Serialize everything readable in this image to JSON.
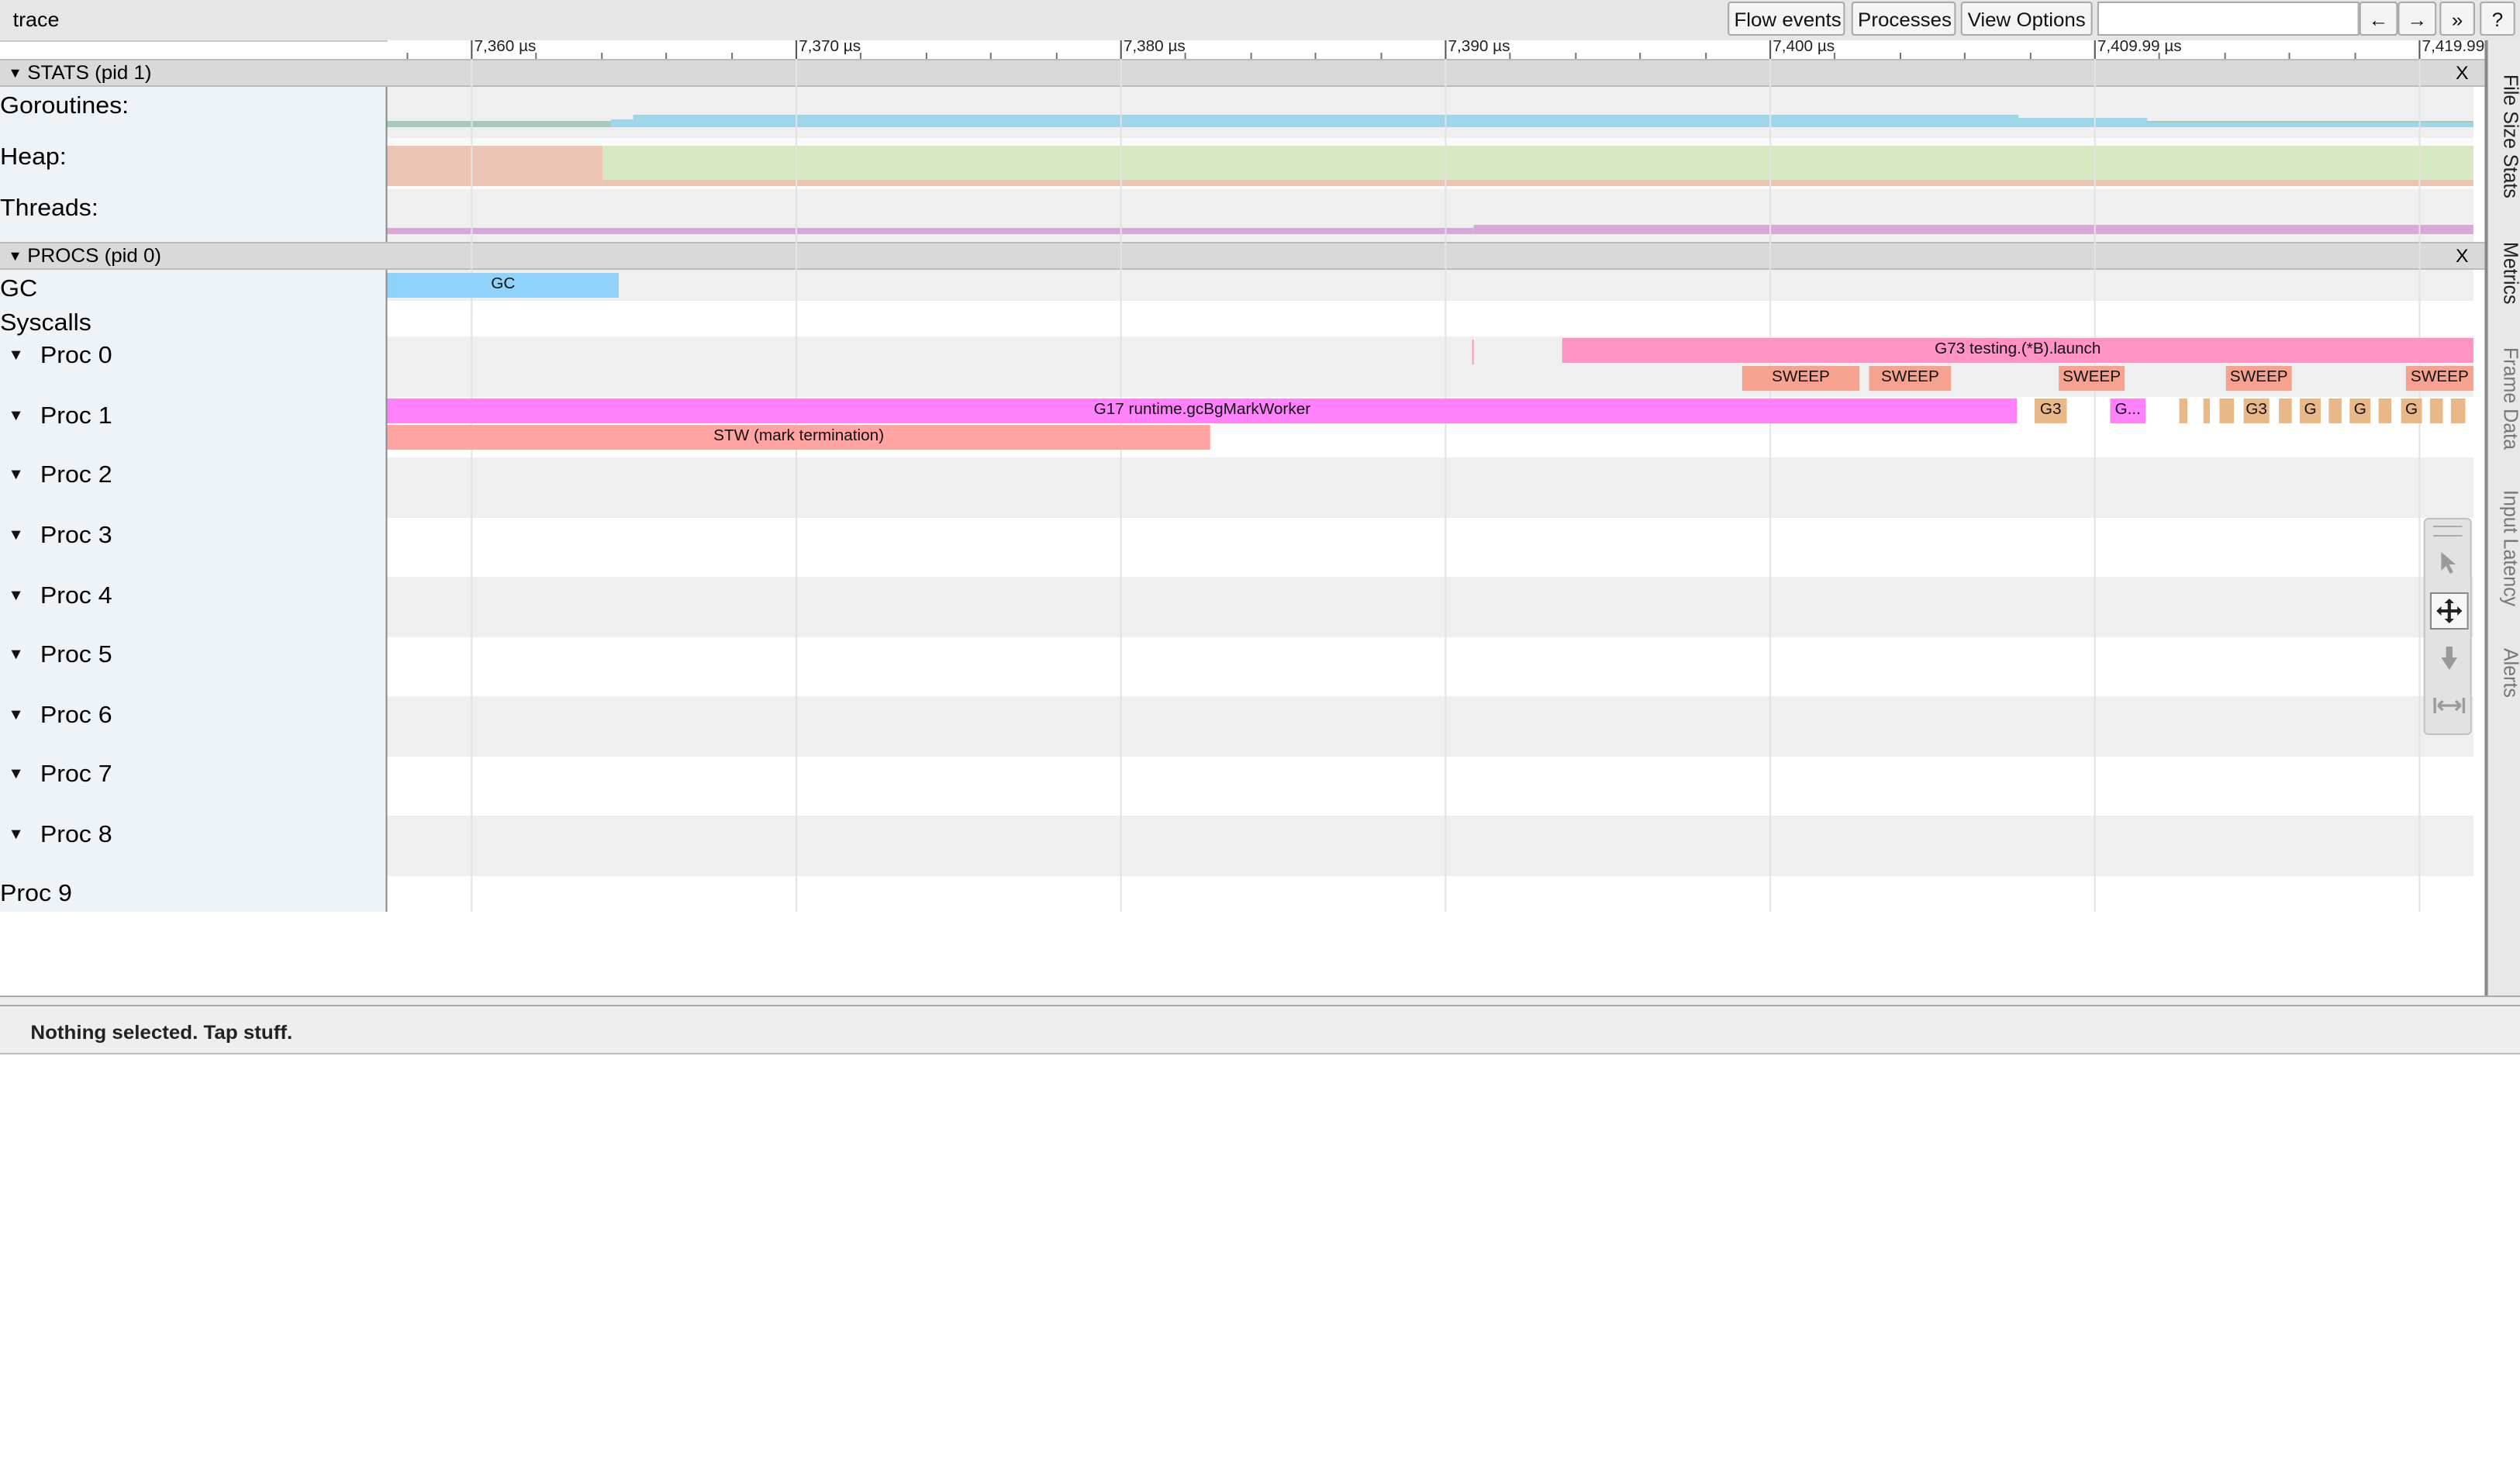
{
  "app": {
    "title": "trace"
  },
  "toolbar": {
    "flow_events": "Flow events",
    "processes": "Processes",
    "view_options": "View Options",
    "nav_prev": "←",
    "nav_next": "→",
    "nav_more": "»",
    "help": "?"
  },
  "ruler": {
    "labels": [
      "7,360 µs",
      "7,370 µs",
      "7,380 µs",
      "7,390 µs",
      "7,400 µs",
      "7,409.99 µs",
      "7,419.99"
    ]
  },
  "stats": {
    "header": "STATS (pid 1)",
    "close": "X",
    "tracks": [
      "Goroutines:",
      "Heap:",
      "Threads:"
    ]
  },
  "procs": {
    "header": "PROCS (pid 0)",
    "close": "X",
    "tracks": [
      "GC",
      "Syscalls",
      "Proc 0",
      "Proc 1",
      "Proc 2",
      "Proc 3",
      "Proc 4",
      "Proc 5",
      "Proc 6",
      "Proc 7",
      "Proc 8",
      "Proc 9"
    ]
  },
  "slices": {
    "gc": "GC",
    "g73": "G73 testing.(*B).launch",
    "sweep": "SWEEP",
    "g17": "G17 runtime.gcBgMarkWorker",
    "stw": "STW (mark termination)",
    "g3": "G3",
    "g_ellipsis": "G...",
    "g": "G"
  },
  "side_tabs": [
    "File Size Stats",
    "Metrics",
    "Frame Data",
    "Input Latency",
    "Alerts"
  ],
  "tools": [
    "select-icon",
    "pan-icon",
    "zoom-icon",
    "timing-icon"
  ],
  "status": {
    "text": "Nothing selected. Tap stuff."
  },
  "colors": {
    "gc": "#8fd3fa",
    "g73": "#ff93c3",
    "sweep": "#f6a28f",
    "g17": "#ff81fb",
    "stw": "#ffa3a3",
    "g3": "#e8b888",
    "heap_alloc": "#ecc4b3",
    "heap_used": "#d7e9c1",
    "goroutines": "#9fd6ea",
    "threads": "#d7a9d7"
  }
}
